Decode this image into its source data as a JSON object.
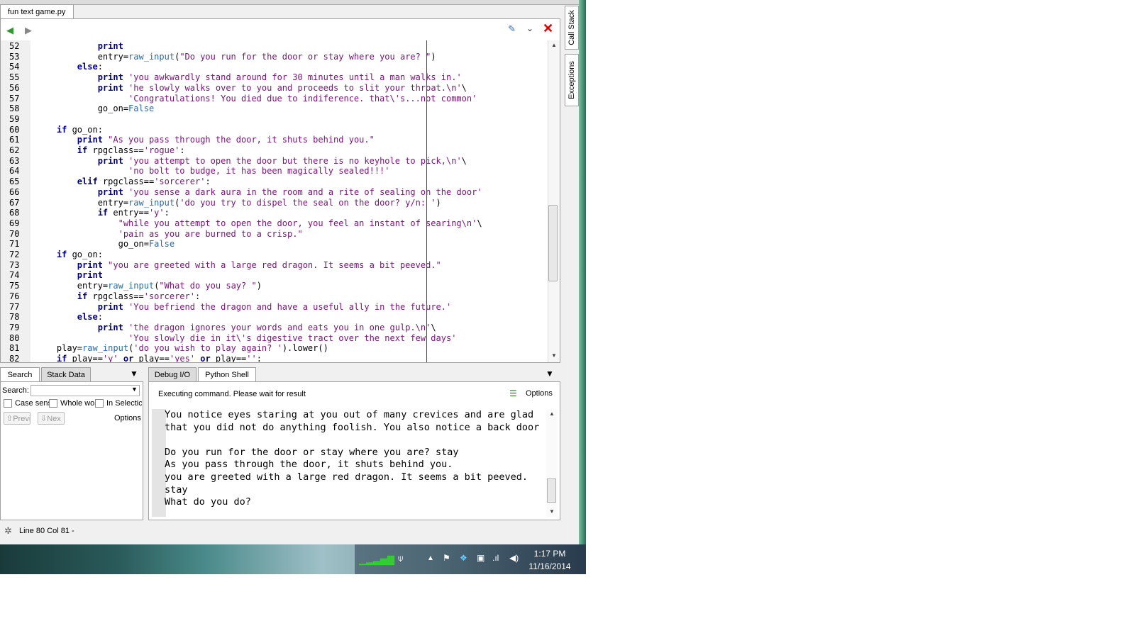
{
  "editor": {
    "file_tab": "fun text game.py",
    "lines": [
      {
        "n": "52",
        "html": "            <span class=\"kw\">print</span>"
      },
      {
        "n": "53",
        "html": "            entry=<span class=\"bi\">raw_input</span>(<span class=\"st\">\"Do you run for the door or stay where you are? \"</span>)"
      },
      {
        "n": "54",
        "html": "        <span class=\"kw\">else</span>:"
      },
      {
        "n": "55",
        "html": "            <span class=\"kw\">print</span> <span class=\"st\">'you awkwardly stand around for 30 minutes until a man walks in.'</span>"
      },
      {
        "n": "56",
        "html": "            <span class=\"kw\">print</span> <span class=\"st\">'he slowly walks over to you and proceeds to slit your throat.\\n'</span>\\"
      },
      {
        "n": "57",
        "html": "                  <span class=\"st\">'Congratulations! You died due to indiference. that\\'s...not common'</span>"
      },
      {
        "n": "58",
        "html": "            go_on=<span class=\"bi\">False</span>"
      },
      {
        "n": "59",
        "html": ""
      },
      {
        "n": "60",
        "html": "    <span class=\"kw\">if</span> go_on:"
      },
      {
        "n": "61",
        "html": "        <span class=\"kw\">print</span> <span class=\"st\">\"As you pass through the door, it shuts behind you.\"</span>"
      },
      {
        "n": "62",
        "html": "        <span class=\"kw\">if</span> rpgclass==<span class=\"st\">'rogue'</span>:"
      },
      {
        "n": "63",
        "html": "            <span class=\"kw\">print</span> <span class=\"st\">'you attempt to open the door but there is no keyhole to pick,\\n'</span>\\"
      },
      {
        "n": "64",
        "html": "                  <span class=\"st\">'no bolt to budge, it has been magically sealed!!!'</span>"
      },
      {
        "n": "65",
        "html": "        <span class=\"kw\">elif</span> rpgclass==<span class=\"st\">'sorcerer'</span>:"
      },
      {
        "n": "66",
        "html": "            <span class=\"kw\">print</span> <span class=\"st\">'you sense a dark aura in the room and a rite of sealing on the door'</span>"
      },
      {
        "n": "67",
        "html": "            entry=<span class=\"bi\">raw_input</span>(<span class=\"st\">'do you try to dispel the seal on the door? y/n: '</span>)"
      },
      {
        "n": "68",
        "html": "            <span class=\"kw\">if</span> entry==<span class=\"st\">'y'</span>:"
      },
      {
        "n": "69",
        "html": "                <span class=\"st\">\"while you attempt to open the door, you feel an instant of searing\\n'</span>\\"
      },
      {
        "n": "70",
        "html": "                <span class=\"st\">'pain as you are burned to a crisp.\"</span>"
      },
      {
        "n": "71",
        "html": "                go_on=<span class=\"bi\">False</span>"
      },
      {
        "n": "72",
        "html": "    <span class=\"kw\">if</span> go_on:"
      },
      {
        "n": "73",
        "html": "        <span class=\"kw\">print</span> <span class=\"st\">\"you are greeted with a large red dragon. It seems a bit peeved.\"</span>"
      },
      {
        "n": "74",
        "html": "        <span class=\"kw\">print</span>"
      },
      {
        "n": "75",
        "html": "        entry=<span class=\"bi\">raw_input</span>(<span class=\"st\">\"What do you say? \"</span>)"
      },
      {
        "n": "76",
        "html": "        <span class=\"kw\">if</span> rpgclass==<span class=\"st\">'sorcerer'</span>:"
      },
      {
        "n": "77",
        "html": "            <span class=\"kw\">print</span> <span class=\"st\">'You befriend the dragon and have a useful ally in the future.'</span>"
      },
      {
        "n": "78",
        "html": "        <span class=\"kw\">else</span>:"
      },
      {
        "n": "79",
        "html": "            <span class=\"kw\">print</span> <span class=\"st\">'the dragon ignores your words and eats you in one gulp.\\n'</span>\\"
      },
      {
        "n": "80",
        "html": "                  <span class=\"st\">'You slowly die in it\\'s digestive tract over the next few days'</span>"
      },
      {
        "n": "81",
        "html": "    play=<span class=\"bi\">raw_input</span>(<span class=\"st\">'do you wish to play again? '</span>).lower()"
      },
      {
        "n": "82",
        "html": "    <span class=\"kw\">if</span> play==<span class=\"st\">'y'</span> <span class=\"kw\">or</span> play==<span class=\"st\">'yes'</span> <span class=\"kw\">or</span> play==<span class=\"st\">''</span>:"
      }
    ]
  },
  "side_tabs": {
    "call_stack": "Call Stack",
    "exceptions": "Exceptions"
  },
  "search_panel": {
    "tab_search": "Search",
    "tab_stack_data": "Stack Data",
    "search_label": "Search:",
    "search_value": "",
    "case_sensitive": "Case sens",
    "whole_word": "Whole wo",
    "in_selection": "In Selectic",
    "prev_button": "Previc",
    "next_button": "Nex",
    "options": "Options"
  },
  "shell_panel": {
    "tab_debug_io": "Debug I/O",
    "tab_python_shell": "Python Shell",
    "status": "Executing command.  Please wait for result",
    "options": "Options",
    "output": "You notice eyes staring at you out of many crevices and are glad\nthat you did not do anything foolish. You also notice a back door\n\nDo you run for the door or stay where you are? stay\nAs you pass through the door, it shuts behind you.\nyou are greeted with a large red dragon. It seems a bit peeved.\nstay\nWhat do you do?"
  },
  "status_bar": {
    "text": "Line 80 Col 81 -"
  },
  "taskbar": {
    "time": "1:17 PM",
    "date": "11/16/2014"
  },
  "colors": {
    "keyword": "#00008b",
    "string": "#7a127a",
    "builtin": "#2a6ab0",
    "edge_line": "#e00000"
  }
}
